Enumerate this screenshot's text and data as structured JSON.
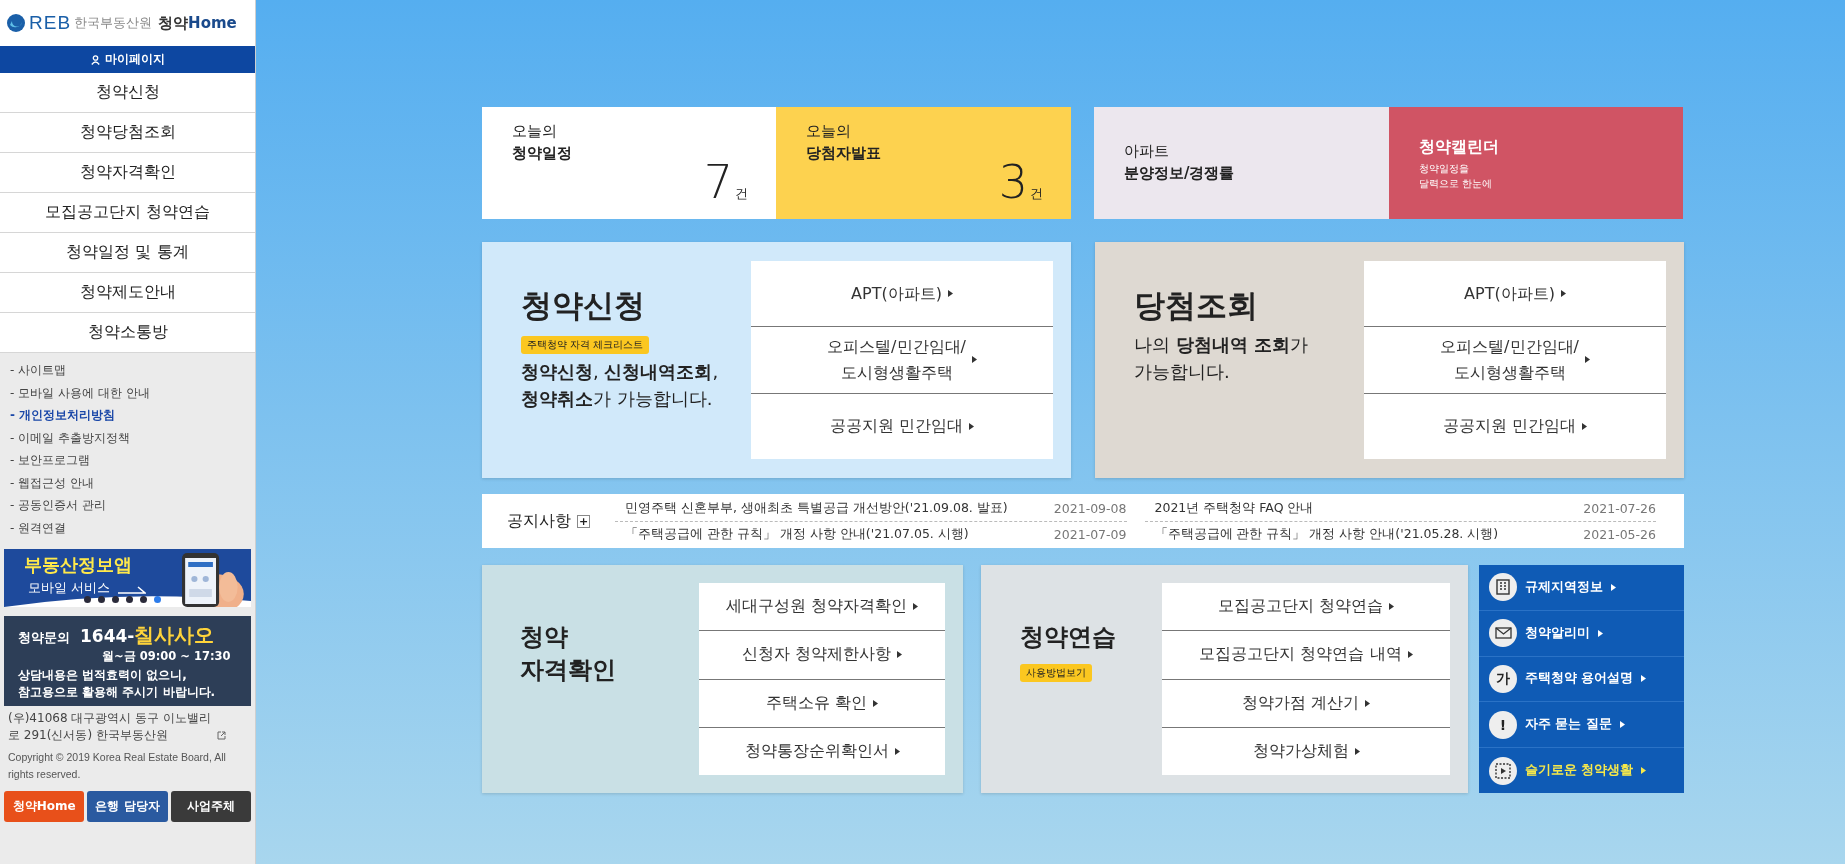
{
  "logo": {
    "mark": "REB",
    "org": "한국부동산원",
    "brand_ko": "청약",
    "brand_en": "Home"
  },
  "mypage": "마이페이지",
  "menu": [
    {
      "label": "청약신청"
    },
    {
      "label": "청약당첨조회"
    },
    {
      "label": "청약자격확인"
    },
    {
      "label": "모집공고단지 청약연습"
    },
    {
      "label": "청약일정 및 통계"
    },
    {
      "label": "청약제도안내"
    },
    {
      "label": "청약소통방"
    }
  ],
  "links": [
    {
      "label": "- 사이트맵",
      "emphasized": false
    },
    {
      "label": "- 모바일 사용에 대한 안내",
      "emphasized": false
    },
    {
      "label": "- 개인정보처리방침",
      "emphasized": true
    },
    {
      "label": "- 이메일 추출방지정책",
      "emphasized": false
    },
    {
      "label": "- 보안프로그램",
      "emphasized": false
    },
    {
      "label": "- 웹접근성 안내",
      "emphasized": false
    },
    {
      "label": "- 공동인증서 관리",
      "emphasized": false
    },
    {
      "label": "- 원격연결",
      "emphasized": false
    }
  ],
  "banner": {
    "title": "부동산정보앱",
    "subtitle": "모바일 서비스",
    "dots": [
      {
        "selected": false
      },
      {
        "selected": false
      },
      {
        "selected": false
      },
      {
        "selected": false
      },
      {
        "selected": false
      },
      {
        "selected": true
      }
    ]
  },
  "contact": {
    "label": "청약문의",
    "number_digits": "1644-",
    "number_word": "칠사사오",
    "hours": "월~금 09:00 ~ 17:30",
    "note": "상담내용은 법적효력이 없으니,\n참고용으로 활용해 주시기 바랍니다."
  },
  "address": "(우)41068 대구광역시 동구 이노밸리로 291(신서동) 한국부동산원",
  "copyright": "Copyright © 2019 Korea Real Estate Board, All rights reserved.",
  "footer_buttons": [
    {
      "label": "청약Home",
      "color": "#e8501a"
    },
    {
      "label": "은행 담당자",
      "color": "#2a5aa0"
    },
    {
      "label": "사업주체",
      "color": "#3a3a3a"
    }
  ],
  "today": [
    {
      "kind": "count",
      "line1": "오늘의",
      "line2": "청약일정",
      "count": "7",
      "unit": "건",
      "color": "#ffffff"
    },
    {
      "kind": "count",
      "line1": "오늘의",
      "line2": "당첨자발표",
      "count": "3",
      "unit": "건",
      "color": "#fdd24f"
    },
    {
      "kind": "plain",
      "line1": "아파트",
      "line2": "분양정보/경쟁률",
      "color": "#ece7ee"
    },
    {
      "kind": "accent",
      "line1": "청약캘린더",
      "line2": "청약일정을\n달력으로 한눈에",
      "color": "#d05464"
    }
  ],
  "big_cards": [
    {
      "title": "청약신청",
      "tag": "주택청약 자격 체크리스트",
      "desc": "**청약신청**, **신청내역조회**,\n**청약취소**가 가능합니다.",
      "color": "#d1e9fa",
      "links": [
        "APT(아파트)",
        "오피스텔/민간임대/\n도시형생활주택",
        "공공지원 민간임대"
      ]
    },
    {
      "title": "당첨조회",
      "desc": "나의 **당첨내역 조회**가\n가능합니다.",
      "color": "#ded9d2",
      "links": [
        "APT(아파트)",
        "오피스텔/민간임대/\n도시형생활주택",
        "공공지원 민간임대"
      ]
    }
  ],
  "notices": {
    "title": "공지사항",
    "more": "+",
    "items": [
      {
        "title": "민영주택 신혼부부, 생애최초 특별공급 개선방안('21.09.08. 발표)",
        "date": "2021-09-08"
      },
      {
        "title": "2021년 주택청약 FAQ 안내",
        "date": "2021-07-26"
      },
      {
        "title": "「주택공급에 관한 규칙」 개정 사항 안내('21.07.05. 시행)",
        "date": "2021-07-09"
      },
      {
        "title": "「주택공급에 관한 규칙」 개정 사항 안내('21.05.28. 시행)",
        "date": "2021-05-26"
      }
    ]
  },
  "bottom_cards": [
    {
      "title": "청약\n자격확인",
      "color": "#c9e0e5",
      "links": [
        "세대구성원 청약자격확인",
        "신청자 청약제한사항",
        "주택소유 확인",
        "청약통장순위확인서"
      ]
    },
    {
      "title": "청약연습",
      "tag": "사용방법보기",
      "color": "#dde2e5",
      "links": [
        "모집공고단지 청약연습",
        "모집공고단지 청약연습 내역",
        "청약가점 계산기",
        "청약가상체험"
      ]
    }
  ],
  "quick_links": [
    {
      "kind": "building",
      "label": "규제지역정보",
      "highlighted": false
    },
    {
      "kind": "mail",
      "label": "청약알리미",
      "highlighted": false
    },
    {
      "kind": "glyph",
      "glyph": "가",
      "label": "주택청약 용어설명",
      "highlighted": false
    },
    {
      "kind": "glyph",
      "glyph": "!",
      "label": "자주 묻는 질문",
      "highlighted": false
    },
    {
      "kind": "video",
      "label": "슬기로운 청약생활",
      "highlighted": true
    }
  ]
}
